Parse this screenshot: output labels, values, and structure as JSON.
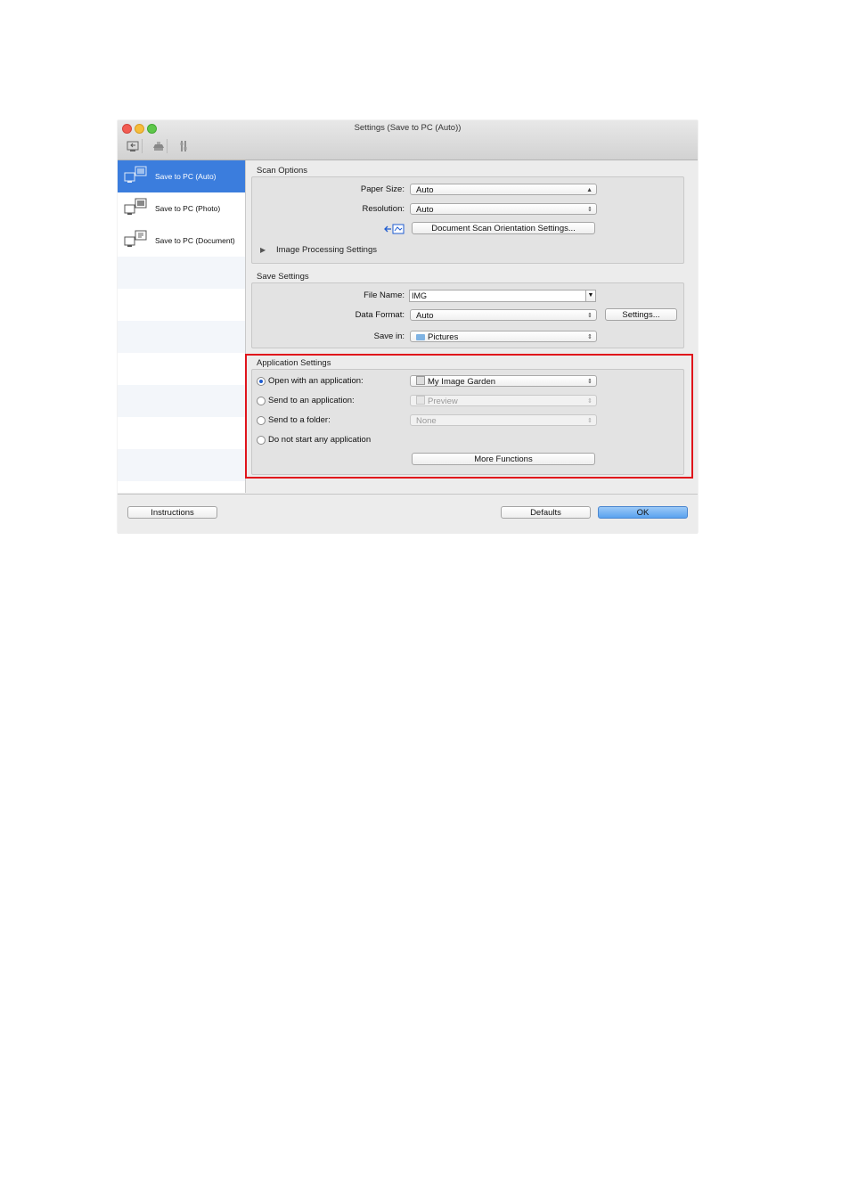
{
  "window": {
    "title": "Settings (Save to PC (Auto))",
    "toolbar": [
      {
        "name": "scan-from-computer-icon"
      },
      {
        "name": "scan-from-operation-panel-icon"
      },
      {
        "name": "general-settings-icon"
      }
    ]
  },
  "sidebar": {
    "items": [
      {
        "label": "Save to PC (Auto)",
        "selected": true
      },
      {
        "label": "Save to PC (Photo)",
        "selected": false
      },
      {
        "label": "Save to PC (Document)",
        "selected": false
      }
    ]
  },
  "scan_options": {
    "title": "Scan Options",
    "paper_size_label": "Paper Size:",
    "paper_size_value": "Auto",
    "resolution_label": "Resolution:",
    "resolution_value": "Auto",
    "orientation_button": "Document Scan Orientation Settings...",
    "image_processing_label": "Image Processing Settings"
  },
  "save_settings": {
    "title": "Save Settings",
    "file_name_label": "File Name:",
    "file_name_value": "IMG",
    "data_format_label": "Data Format:",
    "data_format_value": "Auto",
    "settings_button": "Settings...",
    "save_in_label": "Save in:",
    "save_in_value": "Pictures"
  },
  "application_settings": {
    "title": "Application Settings",
    "open_with_label": "Open with an application:",
    "open_with_value": "My Image Garden",
    "send_to_app_label": "Send to an application:",
    "send_to_app_value": "Preview",
    "send_to_folder_label": "Send to a folder:",
    "send_to_folder_value": "None",
    "do_not_start_label": "Do not start any application",
    "more_functions_button": "More Functions",
    "selected_option": "open_with"
  },
  "footer": {
    "instructions_button": "Instructions",
    "defaults_button": "Defaults",
    "ok_button": "OK"
  },
  "colors": {
    "selection_blue": "#3b7ddd",
    "highlight_red": "#e0141c",
    "ok_button_blue": "#5aa2ef"
  }
}
